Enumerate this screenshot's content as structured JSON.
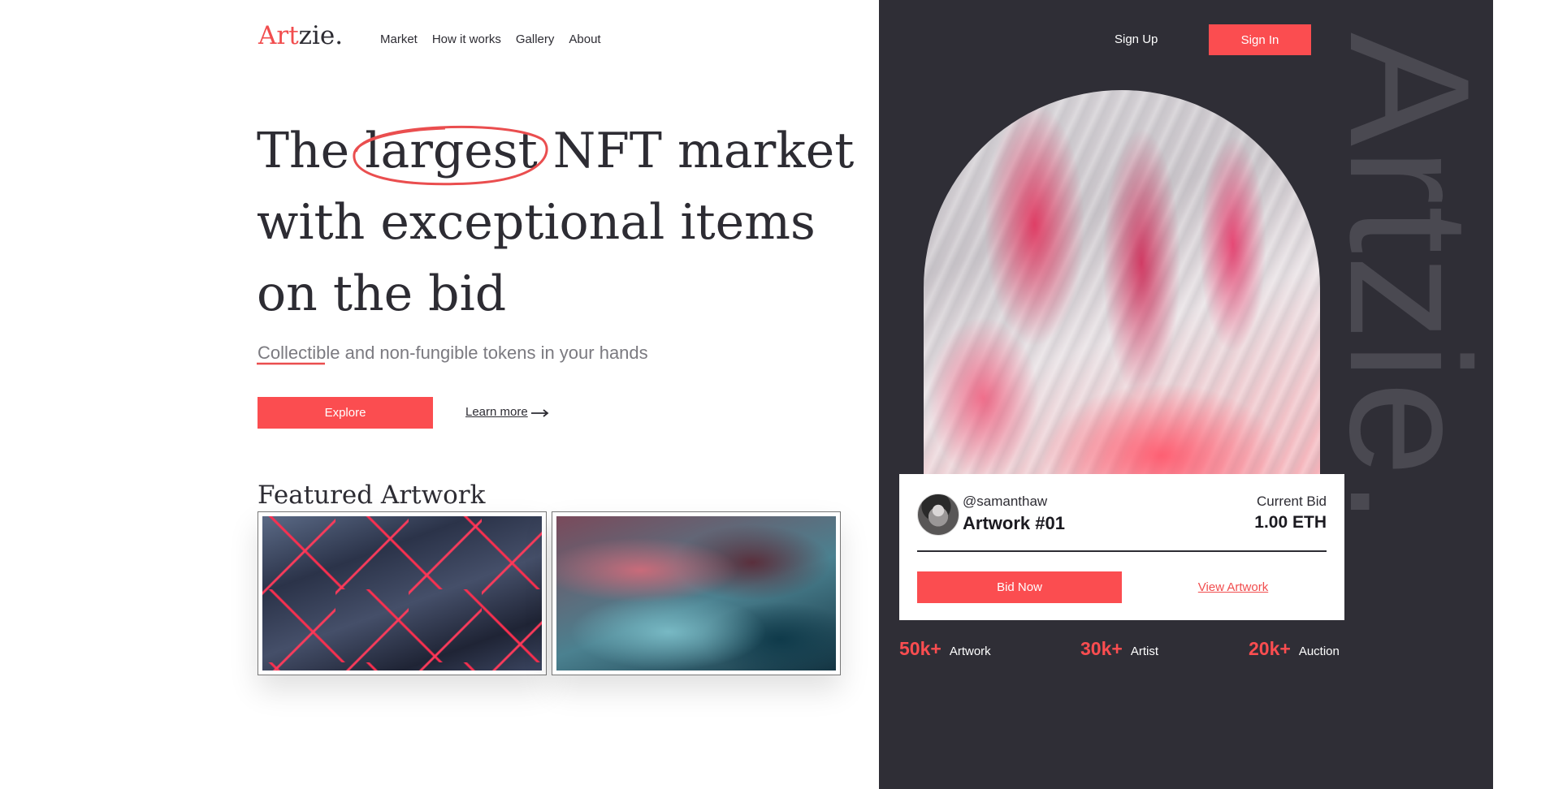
{
  "brand": {
    "logo_accent": "Art",
    "logo_rest": "zie.",
    "accent_color": "#fb4d50",
    "dark_panel_color": "#2f2e36",
    "watermark": "Artzie."
  },
  "nav": {
    "items": [
      "Market",
      "How it works",
      "Gallery",
      "About"
    ]
  },
  "auth": {
    "signup_label": "Sign Up",
    "signin_label": "Sign In"
  },
  "hero": {
    "title_before": "The ",
    "title_highlight": "largest",
    "title_after": " NFT market with exceptional items on the bid",
    "subtitle": "Collectible and non-fungible tokens in your hands",
    "explore_label": "Explore",
    "learn_more_label": "Learn more"
  },
  "featured": {
    "title": "Featured Artwork"
  },
  "bid_card": {
    "handle": "@samanthaw",
    "artwork_name": "Artwork #01",
    "bid_label": "Current Bid",
    "bid_value": "1.00 ETH",
    "bid_now_label": "Bid Now",
    "view_artwork_label": "View Artwork"
  },
  "stats": [
    {
      "value": "50k+",
      "label": "Artwork"
    },
    {
      "value": "30k+",
      "label": "Artist"
    },
    {
      "value": "20k+",
      "label": "Auction"
    }
  ]
}
